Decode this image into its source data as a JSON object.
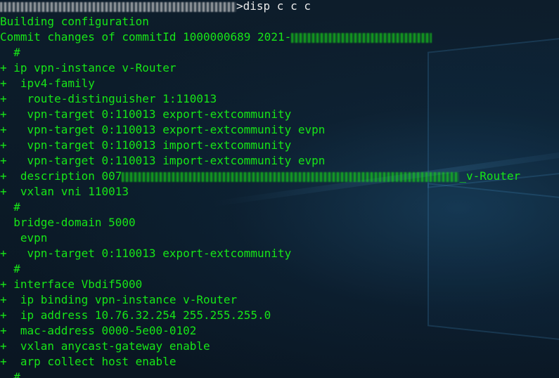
{
  "terminal": {
    "prompt_suffix": ">",
    "command": "disp c c c",
    "lines": [
      {
        "text": "Building configuration",
        "color": "#17e617"
      },
      {
        "text": "Commit changes of commitId 1000000689 2021-",
        "color": "#17e617"
      },
      {
        "text": "  #",
        "color": "#17e617"
      },
      {
        "text": "+ ip vpn-instance v-Router",
        "color": "#17e617"
      },
      {
        "text": "+  ipv4-family",
        "color": "#17e617"
      },
      {
        "text": "+   route-distinguisher 1:110013",
        "color": "#17e617"
      },
      {
        "text": "+   vpn-target 0:110013 export-extcommunity",
        "color": "#17e617"
      },
      {
        "text": "+   vpn-target 0:110013 export-extcommunity evpn",
        "color": "#17e617"
      },
      {
        "text": "+   vpn-target 0:110013 import-extcommunity",
        "color": "#17e617"
      },
      {
        "text": "+   vpn-target 0:110013 import-extcommunity evpn",
        "color": "#17e617"
      },
      {
        "text": "+  description 007",
        "suffix": "_v-Router",
        "color": "#17e617"
      },
      {
        "text": "+  vxlan vni 110013",
        "color": "#17e617"
      },
      {
        "text": "  #",
        "color": "#17e617"
      },
      {
        "text": "  bridge-domain 5000",
        "color": "#17e617"
      },
      {
        "text": "   evpn",
        "color": "#17e617"
      },
      {
        "text": "+   vpn-target 0:110013 export-extcommunity",
        "color": "#17e617"
      },
      {
        "text": "  #",
        "color": "#17e617"
      },
      {
        "text": "+ interface Vbdif5000",
        "color": "#17e617"
      },
      {
        "text": "+  ip binding vpn-instance v-Router",
        "color": "#17e617"
      },
      {
        "text": "+  ip address 10.76.32.254 255.255.255.0",
        "color": "#17e617"
      },
      {
        "text": "+  mac-address 0000-5e00-0102",
        "color": "#17e617"
      },
      {
        "text": "+  vxlan anycast-gateway enable",
        "color": "#17e617"
      },
      {
        "text": "+  arp collect host enable",
        "color": "#17e617"
      },
      {
        "text": "  #",
        "color": "#17e617"
      }
    ]
  },
  "colors": {
    "text_green": "#17e617",
    "prompt_white": "#eaeaea",
    "background": "#0c1c2a"
  }
}
